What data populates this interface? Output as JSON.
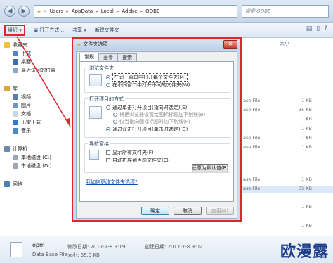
{
  "window": {
    "address_parts": [
      "Users",
      "AppData",
      "Local",
      "Adobe",
      "OOBE"
    ],
    "search_placeholder": "搜索 OOBE"
  },
  "toolbar": {
    "organize": "组织 ▾",
    "open": "打开方式...",
    "share": "共享 ▾",
    "new_folder": "新建文件夹"
  },
  "navpane": {
    "favorites": "收藏夹",
    "downloads": "下载",
    "desktop": "桌面",
    "recent": "最近访问的位置",
    "libraries": "库",
    "videos": "视频",
    "pictures": "图片",
    "documents": "文档",
    "xunlei": "迅雷下载",
    "music": "音乐",
    "computer": "计算机",
    "disk_c": "本地磁盘 (C:)",
    "disk_d": "本地磁盘 (D:)",
    "network": "网络"
  },
  "filelist": {
    "size_header": "大小",
    "rows": [
      {
        "type": "ase File",
        "size": "1 KB"
      },
      {
        "type": "ase File",
        "size": "35 KB"
      },
      {
        "type": "",
        "size": "1 KB"
      },
      {
        "type": "",
        "size": "1 KB"
      },
      {
        "type": "ase File",
        "size": "1 KB"
      },
      {
        "type": "ase File",
        "size": "1 KB"
      },
      {
        "type": "ase File",
        "size": "1 KB"
      },
      {
        "type": "ase File",
        "size": "35 KB"
      },
      {
        "type": "",
        "size": "1 KB"
      },
      {
        "type": "",
        "size": "1 KB"
      }
    ]
  },
  "details": {
    "name": "opm",
    "type": "Data Base File",
    "modified_label": "修改日期: 2017-7-8 9:19",
    "size_label": "大小: 35.0 KB",
    "created_label": "创建日期: 2017-7-8 9:02"
  },
  "dialog": {
    "title": "文件夹选项",
    "close": "✕",
    "tabs": [
      "常规",
      "查看",
      "搜索"
    ],
    "browse_group": "浏览文件夹",
    "browse_same": "在同一窗口中打开每个文件夹(M)",
    "browse_diff": "在不同窗口中打开不同的文件夹(W)",
    "click_group": "打开项目的方式",
    "click_single": "通过单击打开项目(指向时选定)(S)",
    "underline_browser": "根据浏览器设置给图标标题加下划线(B)",
    "underline_hover": "仅当指向图标标题时加下划线(P)",
    "click_double": "通过双击打开项目(单击时选定)(D)",
    "nav_group": "导航窗格",
    "show_all": "显示所有文件夹(F)",
    "auto_expand": "自动扩展到当前文件夹(E)",
    "restore_defaults": "还原为默认值(R)",
    "help_link": "我如何更改文件夹选项?",
    "ok": "确定",
    "cancel": "取消",
    "apply": "应用(A)"
  },
  "watermark": "欧漫露",
  "colors": {
    "highlight": "#e0262b",
    "link": "#0a4db4"
  }
}
